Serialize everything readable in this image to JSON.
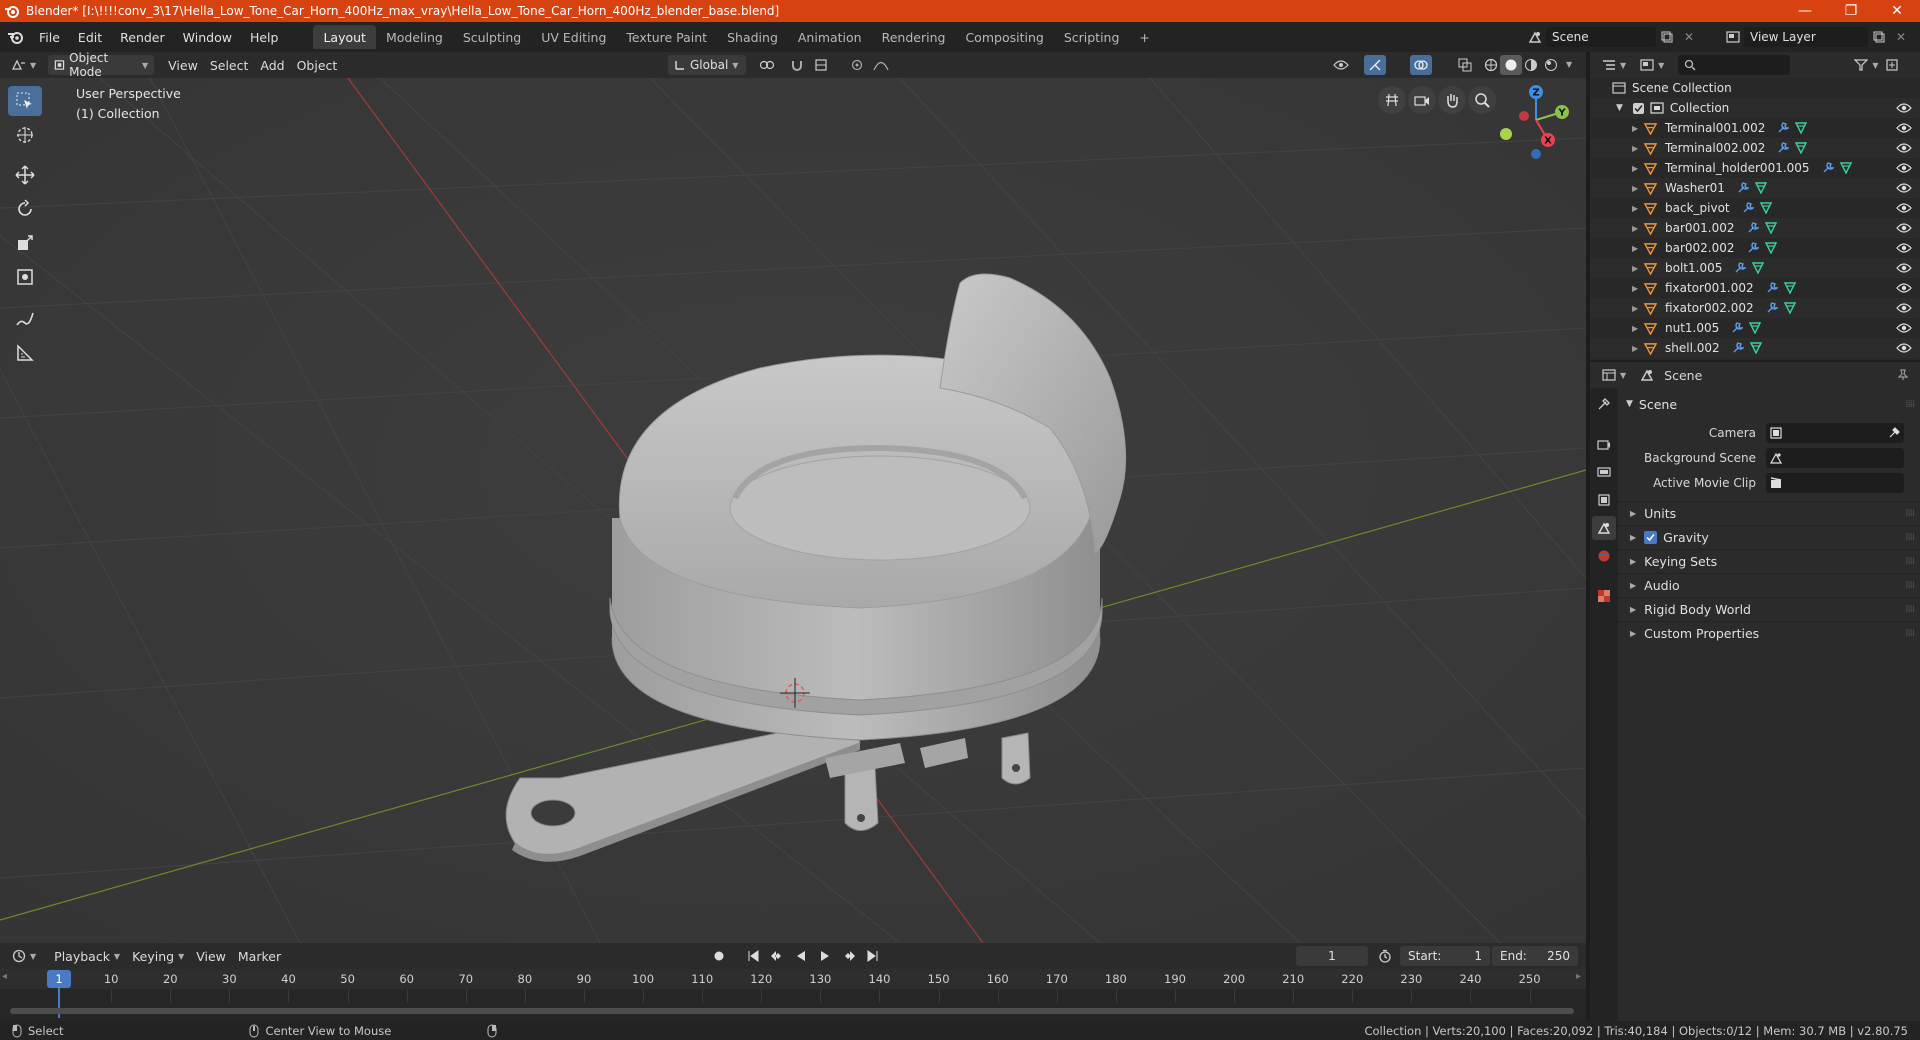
{
  "window": {
    "title": "Blender* [I:\\!!!!conv_3\\17\\Hella_Low_Tone_Car_Horn_400Hz_max_vray\\Hella_Low_Tone_Car_Horn_400Hz_blender_base.blend]",
    "minimize": "—",
    "maximize": "❐",
    "close": "✕"
  },
  "menu": [
    "File",
    "Edit",
    "Render",
    "Window",
    "Help"
  ],
  "workspaces": [
    {
      "label": "Layout",
      "active": true
    },
    {
      "label": "Modeling",
      "active": false
    },
    {
      "label": "Sculpting",
      "active": false
    },
    {
      "label": "UV Editing",
      "active": false
    },
    {
      "label": "Texture Paint",
      "active": false
    },
    {
      "label": "Shading",
      "active": false
    },
    {
      "label": "Animation",
      "active": false
    },
    {
      "label": "Rendering",
      "active": false
    },
    {
      "label": "Compositing",
      "active": false
    },
    {
      "label": "Scripting",
      "active": false
    }
  ],
  "workspace_add": "+",
  "scene_selector": {
    "value": "Scene"
  },
  "view_layer_selector": {
    "value": "View Layer"
  },
  "viewport_header": {
    "mode": "Object Mode",
    "menus": [
      "View",
      "Select",
      "Add",
      "Object"
    ],
    "orientation": "Global"
  },
  "viewport": {
    "perspective": "User Perspective",
    "collection": "(1) Collection",
    "gizmo_axes": {
      "x": "X",
      "y": "Y",
      "z": "Z"
    }
  },
  "timeline_header": {
    "menus": [
      "Playback",
      "Keying",
      "View",
      "Marker"
    ],
    "current_frame": "1",
    "start_label": "Start:",
    "start": "1",
    "end_label": "End:",
    "end": "250"
  },
  "timeline": {
    "ticks": [
      "10",
      "20",
      "30",
      "40",
      "50",
      "60",
      "70",
      "80",
      "90",
      "100",
      "110",
      "120",
      "130",
      "140",
      "150",
      "160",
      "170",
      "180",
      "190",
      "200",
      "210",
      "220",
      "230",
      "240",
      "250"
    ],
    "playhead": "1"
  },
  "statusbar": {
    "left_action": "Select",
    "middle_action": "Center View to Mouse",
    "stats": "Collection | Verts:20,100 | Faces:20,092 | Tris:40,184 | Objects:0/12 | Mem: 30.7 MB | v2.80.75"
  },
  "outliner": {
    "root": "Scene Collection",
    "collection": "Collection",
    "objects": [
      "Terminal001.002",
      "Terminal002.002",
      "Terminal_holder001.005",
      "Washer01",
      "back_pivot",
      "bar001.002",
      "bar002.002",
      "bolt1.005",
      "fixator001.002",
      "fixator002.002",
      "nut1.005",
      "shell.002"
    ]
  },
  "properties": {
    "header_title": "Scene",
    "section_title": "Scene",
    "rows": [
      {
        "label": "Camera"
      },
      {
        "label": "Background Scene"
      },
      {
        "label": "Active Movie Clip"
      }
    ],
    "subpanels": [
      "Units",
      "Gravity",
      "Keying Sets",
      "Audio",
      "Rigid Body World",
      "Custom Properties"
    ]
  },
  "colors": {
    "titlebar": "#d64310",
    "active_tool": "#4a6e9a",
    "axis_x": "#e8434f",
    "axis_y": "#8bc34a",
    "axis_z": "#3d8fe6",
    "mesh_icon": "#e8923a",
    "modifier_icon": "#5aa0f0",
    "data_icon": "#3ad0a0"
  }
}
